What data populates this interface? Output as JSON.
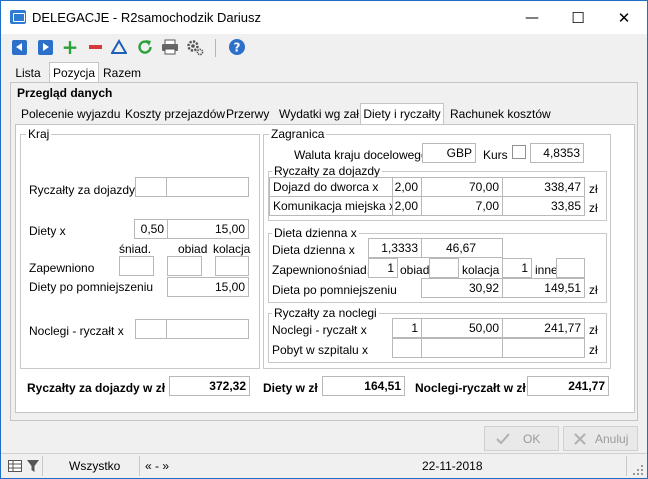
{
  "window": {
    "title": "DELEGACJE - R2samochodzik Dariusz",
    "minimize": "—",
    "maximize": "☐",
    "close": "✕"
  },
  "toolbar": {
    "icons": [
      "prev-record-icon",
      "next-record-icon",
      "add-icon",
      "delete-icon",
      "filter-icon",
      "refresh-icon",
      "print-icon",
      "settings-icon",
      "help-icon"
    ],
    "accent": "#2c70c9"
  },
  "tabs_top": [
    "Lista",
    "Pozycja",
    "Razem"
  ],
  "section_title": "Przegląd danych",
  "tabs_inner": [
    "Polecenie wyjazdu",
    "Koszty przejazdów",
    "Przerwy",
    "Wydatki wg zał.",
    "Diety i ryczałty",
    "Rachunek kosztów"
  ],
  "kraj": {
    "title": "Kraj",
    "ryczalty_label": "Ryczałty za dojazdy x",
    "ryczalty_value": "",
    "ryczalty_amount": "",
    "diety_label": "Diety x",
    "diety_value": "0,50",
    "diety_amount": "15,00",
    "sniad_label": "śniad.",
    "obiad_label": "obiad",
    "kolacja_label": "kolacja",
    "zapewniono_label": "Zapewniono",
    "sniad_value": "",
    "obiad_value": "",
    "kolacja_value": "",
    "diety_pomn_label": "Diety po pomniejszeniu",
    "diety_pomn_value": "15,00",
    "noclegi_label": "Noclegi - ryczałt x",
    "noclegi_value": "",
    "noclegi_amount": ""
  },
  "zagranica": {
    "title": "Zagranica",
    "waluta_label": "Waluta kraju docelowego",
    "waluta_value": "GBP",
    "kurs_label": "Kurs",
    "kurs_value": "4,8353",
    "ryczalty": {
      "title": "Ryczałty za dojazdy",
      "rows": [
        {
          "label": "Dojazd do dworca x",
          "qty": "2,00",
          "rate": "70,00",
          "amount": "338,47",
          "currency": "zł"
        },
        {
          "label": "Komunikacja miejska x",
          "qty": "2,00",
          "rate": "7,00",
          "amount": "33,85",
          "currency": "zł"
        }
      ]
    },
    "dieta": {
      "title": "Dieta dzienna x",
      "dzienna_label": "Dieta dzienna x",
      "dzienna_qty": "1,3333",
      "dzienna_rate": "46,67",
      "zapewniono_label": "Zapewniono",
      "sniad_label": "śniad.",
      "sniad_value": "1",
      "obiad_label": "obiad",
      "obiad_value": "",
      "kolacja_label": "kolacja",
      "kolacja_value": "1",
      "inne_label": "inne",
      "inne_value": "",
      "pomn_label": "Dieta po pomniejszeniu",
      "pomn_rate": "30,92",
      "pomn_amount": "149,51",
      "currency": "zł"
    },
    "noclegi": {
      "title": "Ryczałty za noclegi",
      "rows": [
        {
          "label": "Noclegi - ryczałt x",
          "qty": "1",
          "rate": "50,00",
          "amount": "241,77",
          "currency": "zł"
        },
        {
          "label": "Pobyt w szpitalu x",
          "qty": "",
          "rate": "",
          "amount": "",
          "currency": "zł"
        }
      ]
    }
  },
  "totals": {
    "ryczalty_label": "Ryczałty za dojazdy w zł",
    "ryczalty_value": "372,32",
    "diety_label": "Diety w zł",
    "diety_value": "164,51",
    "noclegi_label": "Noclegi-ryczałt w zł",
    "noclegi_value": "241,77"
  },
  "buttons": {
    "ok": "OK",
    "cancel": "Anuluj"
  },
  "status": {
    "filter": "Wszystko",
    "nav": "« - »",
    "date": "22-11-2018"
  }
}
